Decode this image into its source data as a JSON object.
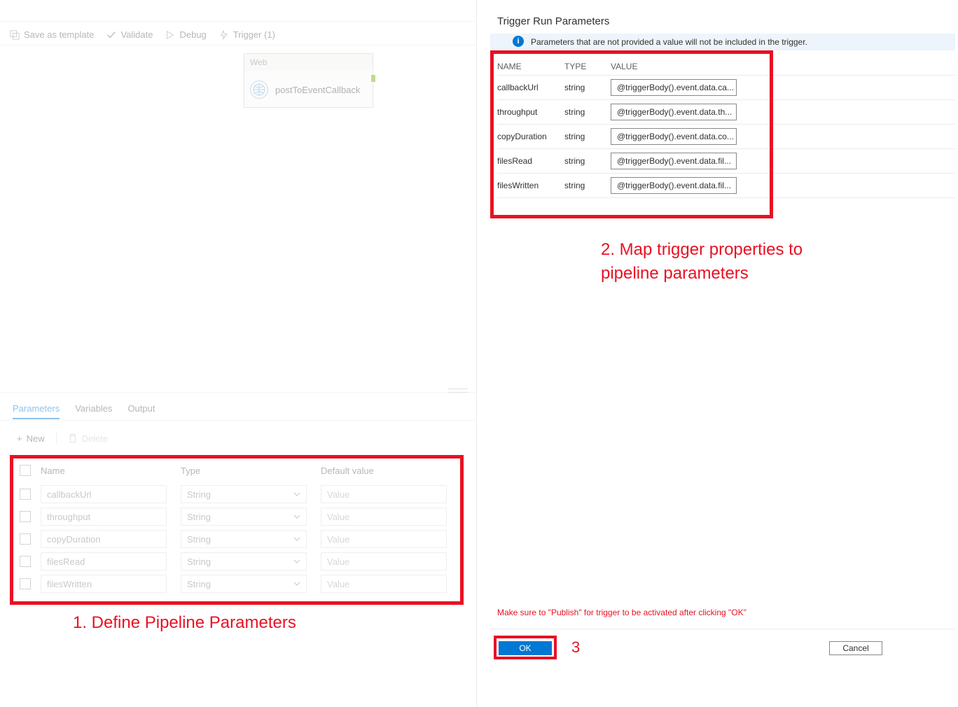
{
  "toolbar": {
    "save_template": "Save as template",
    "validate": "Validate",
    "debug": "Debug",
    "trigger": "Trigger (1)"
  },
  "canvas": {
    "node_type": "Web",
    "node_name": "postToEventCallback"
  },
  "tabs": {
    "parameters": "Parameters",
    "variables": "Variables",
    "output": "Output"
  },
  "subtoolbar": {
    "new": "New",
    "delete": "Delete"
  },
  "param_table": {
    "header_name": "Name",
    "header_type": "Type",
    "header_default": "Default value",
    "value_placeholder": "Value",
    "rows": [
      {
        "name": "callbackUrl",
        "type": "String"
      },
      {
        "name": "throughput",
        "type": "String"
      },
      {
        "name": "copyDuration",
        "type": "String"
      },
      {
        "name": "filesRead",
        "type": "String"
      },
      {
        "name": "filesWritten",
        "type": "String"
      }
    ]
  },
  "annotations": {
    "a1": "1. Define Pipeline Parameters",
    "a2_line1": "2. Map trigger properties to",
    "a2_line2": "pipeline parameters",
    "a3": "3"
  },
  "panel": {
    "title": "Trigger Run Parameters",
    "info": "Parameters that are not provided a value will not be included in the trigger.",
    "publish_note": "Make sure to \"Publish\" for trigger to be activated after clicking \"OK\"",
    "header_name": "NAME",
    "header_type": "TYPE",
    "header_value": "VALUE",
    "rows": [
      {
        "name": "callbackUrl",
        "type": "string",
        "value": "@triggerBody().event.data.ca..."
      },
      {
        "name": "throughput",
        "type": "string",
        "value": "@triggerBody().event.data.th..."
      },
      {
        "name": "copyDuration",
        "type": "string",
        "value": "@triggerBody().event.data.co..."
      },
      {
        "name": "filesRead",
        "type": "string",
        "value": "@triggerBody().event.data.fil..."
      },
      {
        "name": "filesWritten",
        "type": "string",
        "value": "@triggerBody().event.data.fil..."
      }
    ],
    "ok": "OK",
    "cancel": "Cancel"
  }
}
